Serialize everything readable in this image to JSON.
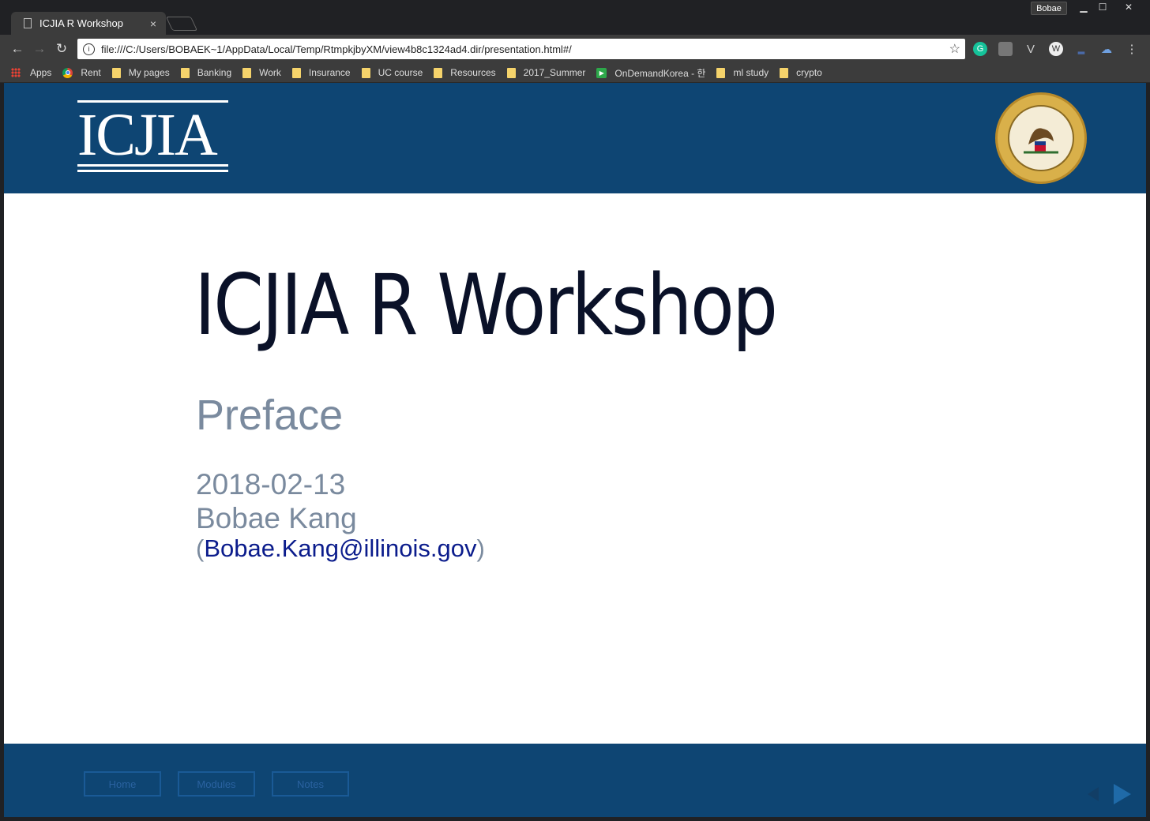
{
  "browser": {
    "tab_title": "ICJIA R Workshop",
    "tab_close": "×",
    "profile_name": "Bobae",
    "url": "file:///C:/Users/BOBAEK~1/AppData/Local/Temp/RtmpkjbyXM/view4b8c1324ad4.dir/presentation.html#/",
    "bookmarks": [
      "Apps",
      "Rent",
      "My pages",
      "Banking",
      "Work",
      "Insurance",
      "UC course",
      "Resources",
      "2017_Summer",
      "OnDemandKorea - 한",
      "ml study",
      "crypto"
    ]
  },
  "slide": {
    "logo": "ICJIA",
    "title": "ICJIA R Workshop",
    "subtitle": "Preface",
    "date": "2018-02-13",
    "author": "Bobae Kang",
    "email_open": "(",
    "email": "Bobae.Kang@illinois.gov",
    "email_close": ")"
  },
  "footer": {
    "buttons": [
      "Home",
      "Modules",
      "Notes"
    ]
  },
  "colors": {
    "header_bg": "#0e4573",
    "title": "#0a1128",
    "muted_text": "#7a8a9e",
    "link": "#0b1c8c"
  }
}
